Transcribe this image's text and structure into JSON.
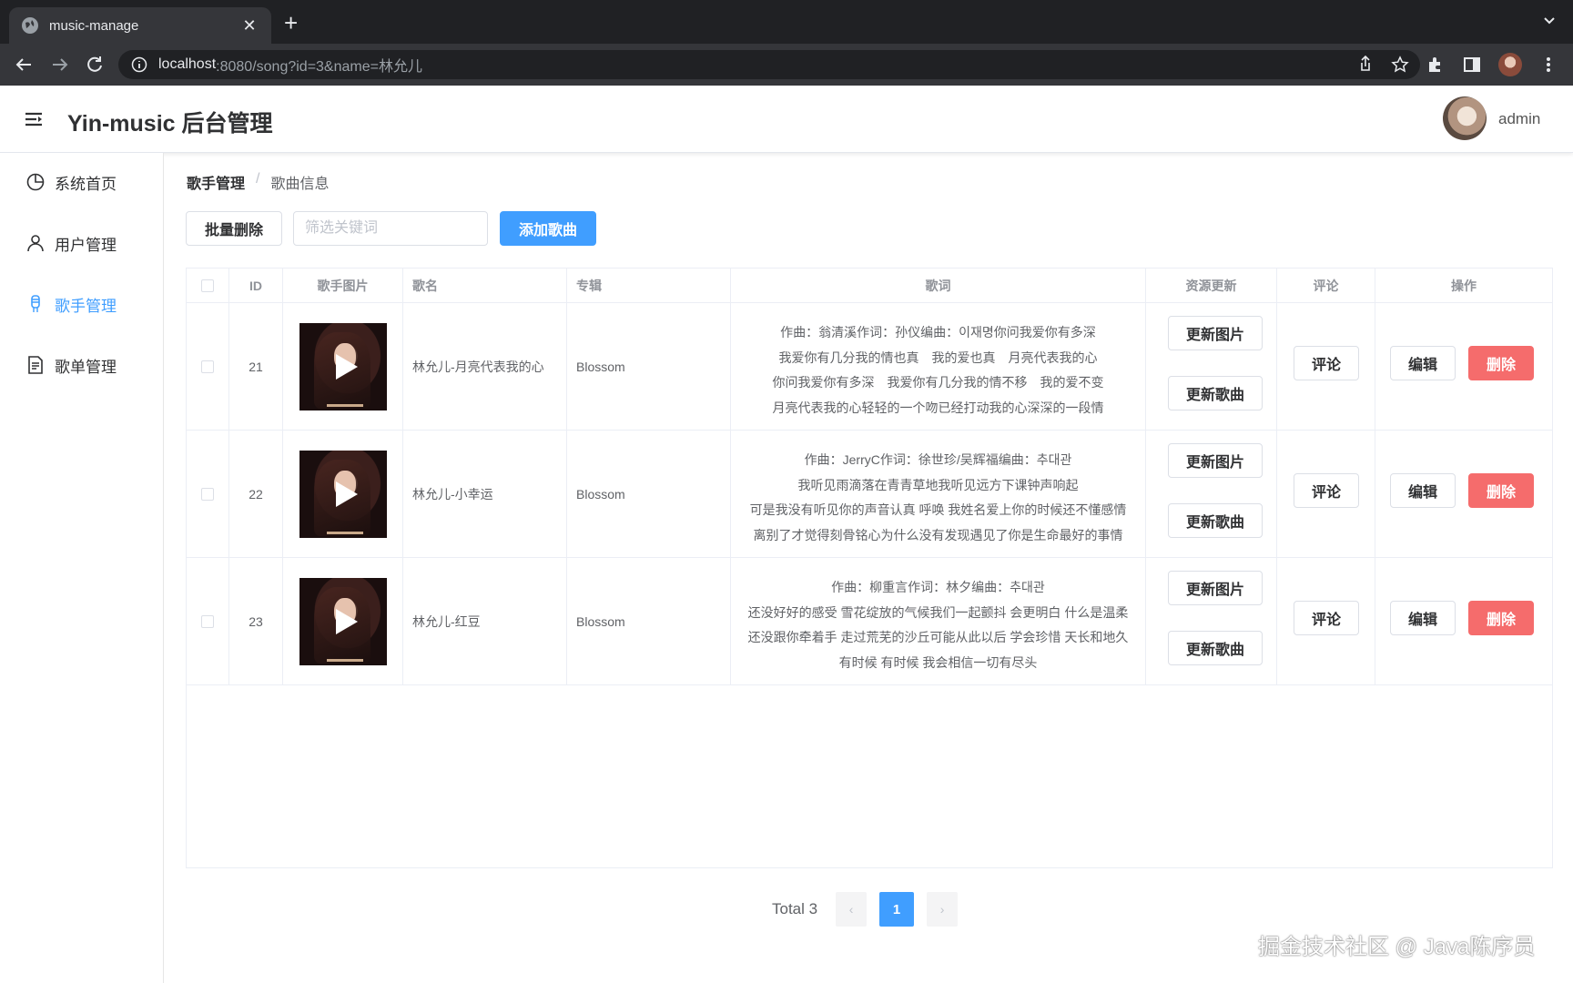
{
  "browser": {
    "tab_title": "music-manage",
    "url_host": "localhost",
    "url_rest": ":8080/song?id=3&name=林允儿"
  },
  "header": {
    "title": "Yin-music 后台管理",
    "username": "admin"
  },
  "sidebar": {
    "items": [
      {
        "label": "系统首页",
        "icon": "pie-chart-icon"
      },
      {
        "label": "用户管理",
        "icon": "user-icon"
      },
      {
        "label": "歌手管理",
        "icon": "microphone-icon",
        "active": true
      },
      {
        "label": "歌单管理",
        "icon": "document-icon"
      }
    ]
  },
  "breadcrumb": {
    "first": "歌手管理",
    "separator": "/",
    "current": "歌曲信息"
  },
  "toolbar": {
    "batch_delete": "批量删除",
    "search_placeholder": "筛选关键词",
    "add_song": "添加歌曲"
  },
  "table": {
    "headers": {
      "id": "ID",
      "image": "歌手图片",
      "name": "歌名",
      "album": "专辑",
      "lyrics": "歌词",
      "resource": "资源更新",
      "comment": "评论",
      "action": "操作"
    },
    "rows": [
      {
        "id": "21",
        "name": "林允儿-月亮代表我的心",
        "album": "Blossom",
        "lyrics": [
          "作曲：翁清溪作词：孙仪编曲：이재명你问我爱你有多深",
          "我爱你有几分我的情也真　我的爱也真　月亮代表我的心",
          "你问我爱你有多深　我爱你有几分我的情不移　我的爱不变",
          "月亮代表我的心轻轻的一个吻已经打动我的心深深的一段情"
        ]
      },
      {
        "id": "22",
        "name": "林允儿-小幸运",
        "album": "Blossom",
        "lyrics": [
          "作曲：JerryC作词：徐世珍/吴辉福编曲：추대관",
          "我听见雨滴落在青青草地我听见远方下课钟声响起",
          "可是我没有听见你的声音认真 呼唤 我姓名爱上你的时候还不懂感情",
          "离别了才觉得刻骨铭心为什么没有发现遇见了你是生命最好的事情"
        ]
      },
      {
        "id": "23",
        "name": "林允儿-红豆",
        "album": "Blossom",
        "lyrics": [
          "作曲：柳重言作词：林夕编曲：추대관",
          "还没好好的感受 雪花绽放的气候我们一起颤抖 会更明白 什么是温柔",
          "还没跟你牵着手 走过荒芜的沙丘可能从此以后 学会珍惜 天长和地久",
          "有时候 有时候 我会相信一切有尽头"
        ]
      }
    ],
    "update_image": "更新图片",
    "update_song": "更新歌曲",
    "comment": "评论",
    "edit": "编辑",
    "delete": "删除"
  },
  "pagination": {
    "total": "Total 3",
    "current": "1",
    "prev": "‹",
    "next": "›"
  },
  "watermark": "掘金技术社区 @ Java陈序员"
}
